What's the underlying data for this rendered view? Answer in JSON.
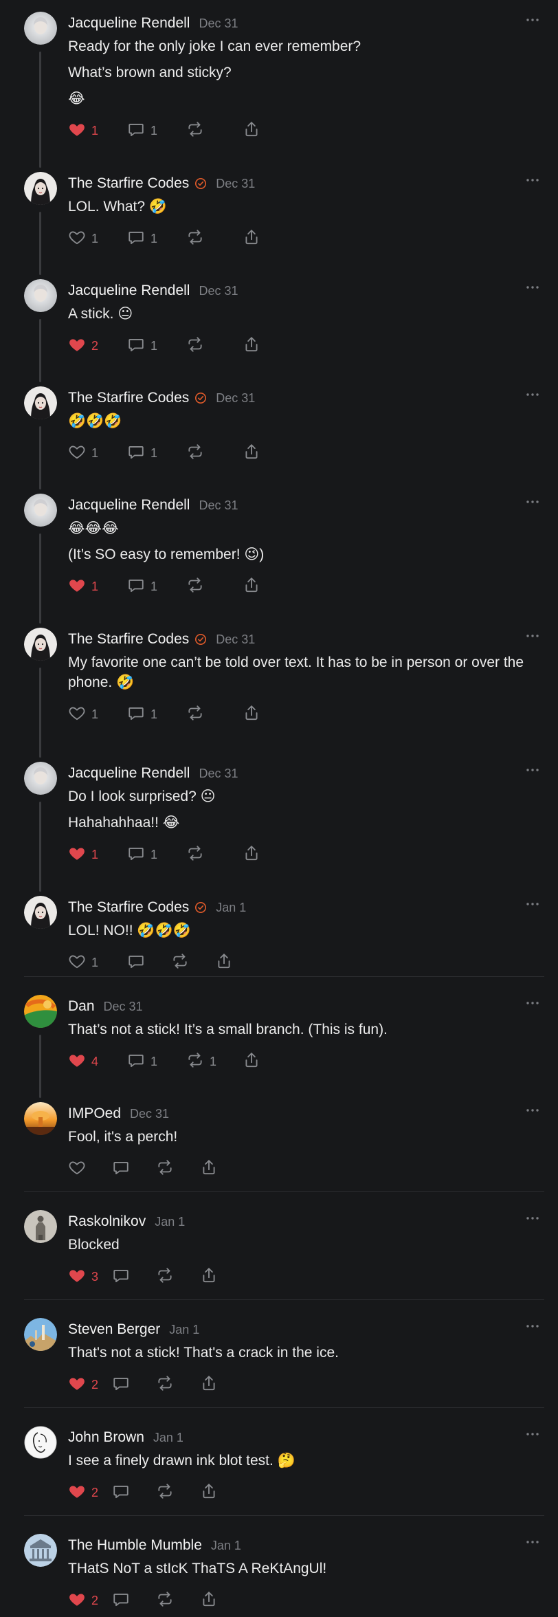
{
  "colors": {
    "background": "#17181a",
    "liked": "#e0474d",
    "verified": "#e25b2a",
    "muted": "#7d7f84"
  },
  "posts": [
    {
      "author": "Jacqueline Rendell",
      "verified": false,
      "date": "Dec 31",
      "avatar": "jacqueline",
      "paragraphs": [
        "Ready for the only joke I can ever remember?",
        "What’s brown and sticky?",
        "😂"
      ],
      "likes": "1",
      "liked": true,
      "replies": "1",
      "reposts": "",
      "thread": true
    },
    {
      "author": "The Starfire Codes",
      "verified": true,
      "date": "Dec 31",
      "avatar": "starfire",
      "paragraphs": [
        "LOL. What? 🤣"
      ],
      "likes": "1",
      "liked": false,
      "replies": "1",
      "reposts": "",
      "thread": true
    },
    {
      "author": "Jacqueline Rendell",
      "verified": false,
      "date": "Dec 31",
      "avatar": "jacqueline",
      "paragraphs": [
        "A stick. 😐"
      ],
      "likes": "2",
      "liked": true,
      "replies": "1",
      "reposts": "",
      "thread": true
    },
    {
      "author": "The Starfire Codes",
      "verified": true,
      "date": "Dec 31",
      "avatar": "starfire",
      "paragraphs": [
        "🤣🤣🤣"
      ],
      "likes": "1",
      "liked": false,
      "replies": "1",
      "reposts": "",
      "thread": true
    },
    {
      "author": "Jacqueline Rendell",
      "verified": false,
      "date": "Dec 31",
      "avatar": "jacqueline",
      "paragraphs": [
        "😂😂😂",
        "(It’s SO easy to remember! 😉)"
      ],
      "likes": "1",
      "liked": true,
      "replies": "1",
      "reposts": "",
      "thread": true
    },
    {
      "author": "The Starfire Codes",
      "verified": true,
      "date": "Dec 31",
      "avatar": "starfire",
      "paragraphs": [
        "My favorite one can’t be told over text. It has to be in person or over the phone. 🤣"
      ],
      "likes": "1",
      "liked": false,
      "replies": "1",
      "reposts": "",
      "thread": true
    },
    {
      "author": "Jacqueline Rendell",
      "verified": false,
      "date": "Dec 31",
      "avatar": "jacqueline",
      "paragraphs": [
        "Do I look surprised? 😐",
        "Hahahahhaa!! 😂"
      ],
      "likes": "1",
      "liked": true,
      "replies": "1",
      "reposts": "",
      "thread": true
    },
    {
      "author": "The Starfire Codes",
      "verified": true,
      "date": "Jan 1",
      "avatar": "starfire",
      "paragraphs": [
        "LOL! NO!! 🤣🤣🤣"
      ],
      "likes": "1",
      "liked": false,
      "replies": "",
      "reposts": "",
      "thread": false,
      "separator": true
    },
    {
      "author": "Dan",
      "verified": false,
      "date": "Dec 31",
      "avatar": "dan",
      "paragraphs": [
        "That’s not a stick! It’s a small branch. (This is fun)."
      ],
      "likes": "4",
      "liked": true,
      "replies": "1",
      "reposts": "1",
      "thread": true
    },
    {
      "author": "IMPOed",
      "verified": false,
      "date": "Dec 31",
      "avatar": "impoed",
      "paragraphs": [
        "Fool, it's a perch!"
      ],
      "likes": "",
      "liked": false,
      "replies": "",
      "reposts": "",
      "thread": false,
      "separator": true
    },
    {
      "author": "Raskolnikov",
      "verified": false,
      "date": "Jan 1",
      "avatar": "raskolnikov",
      "paragraphs": [
        "Blocked"
      ],
      "likes": "3",
      "liked": true,
      "replies": "",
      "reposts": "",
      "thread": false,
      "separator": true
    },
    {
      "author": "Steven Berger",
      "verified": false,
      "date": "Jan 1",
      "avatar": "steven",
      "paragraphs": [
        "That's not a stick! That's a crack in the ice."
      ],
      "likes": "2",
      "liked": true,
      "replies": "",
      "reposts": "",
      "thread": false,
      "separator": true
    },
    {
      "author": "John Brown",
      "verified": false,
      "date": "Jan 1",
      "avatar": "john",
      "paragraphs": [
        "I see a finely drawn ink blot test. 🤔"
      ],
      "likes": "2",
      "liked": true,
      "replies": "",
      "reposts": "",
      "thread": false,
      "separator": true
    },
    {
      "author": "The Humble Mumble",
      "verified": false,
      "date": "Jan 1",
      "avatar": "humble",
      "paragraphs": [
        "THatS NoT a stIcK ThaTS A ReKtAngUl!"
      ],
      "likes": "2",
      "liked": true,
      "replies": "",
      "reposts": "",
      "thread": false
    }
  ]
}
